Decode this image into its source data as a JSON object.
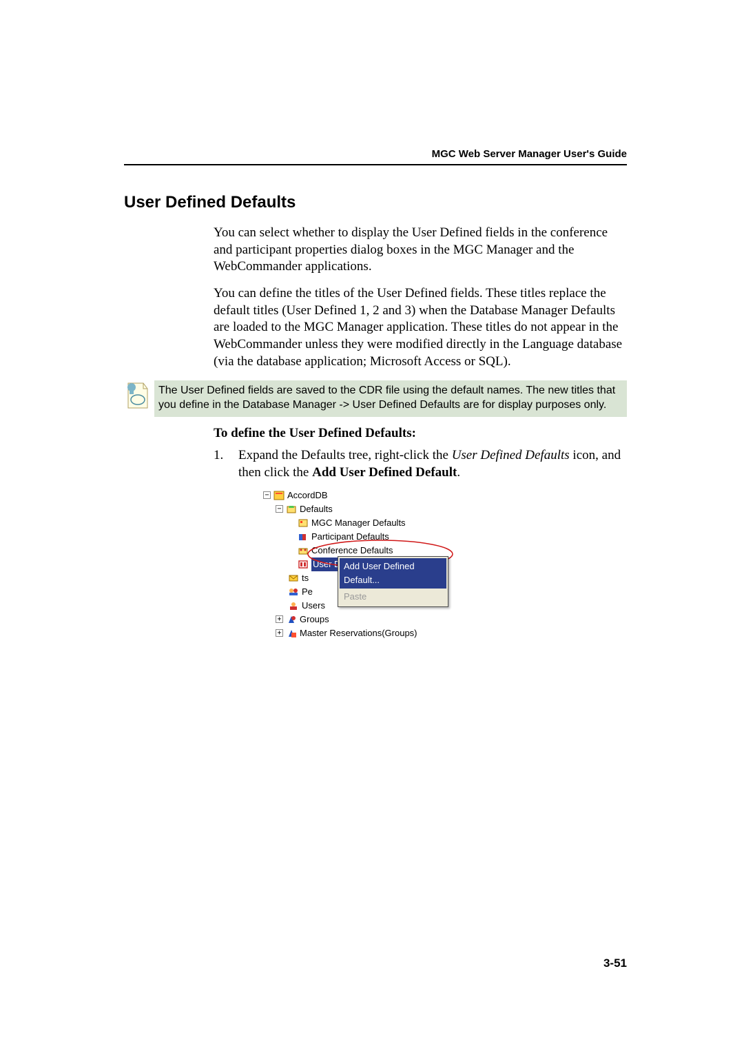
{
  "header": {
    "guide_title": "MGC Web Server Manager User's Guide"
  },
  "section": {
    "title": "User Defined Defaults",
    "para1": "You can select whether to display the User Defined fields in the conference and participant properties dialog boxes in the MGC Manager and the WebCommander applications.",
    "para2": "You can define the titles of the User Defined fields. These titles replace the default titles (User Defined 1, 2 and 3) when the Database Manager Defaults are loaded to the MGC Manager application. These titles do not appear in the WebCommander unless they were modified directly in the Language database (via the database application; Microsoft Access or SQL).",
    "note": "The User Defined fields are saved to the CDR file using the default names. The new titles that you define in the Database Manager -> User Defined Defaults are for display purposes only.",
    "subhead": "To define the User Defined Defaults:",
    "step1_prefix": "Expand the Defaults tree, right-click the ",
    "step1_italic": "User Defined Defaults",
    "step1_mid": " icon, and then click the ",
    "step1_bold": "Add User Defined Default",
    "step1_suffix": "."
  },
  "tree": {
    "root": "AccordDB",
    "defaults": "Defaults",
    "mgc": "MGC Manager Defaults",
    "participant": "Participant Defaults",
    "conference": "Conference Defaults",
    "userdef": "User Defined Defaults",
    "ts": "ts",
    "pe": "Pe",
    "users": "Users",
    "groups": "Groups",
    "master": "Master Reservations(Groups)"
  },
  "menu": {
    "add": "Add User Defined Default...",
    "paste": "Paste"
  },
  "page_number": "3-51"
}
